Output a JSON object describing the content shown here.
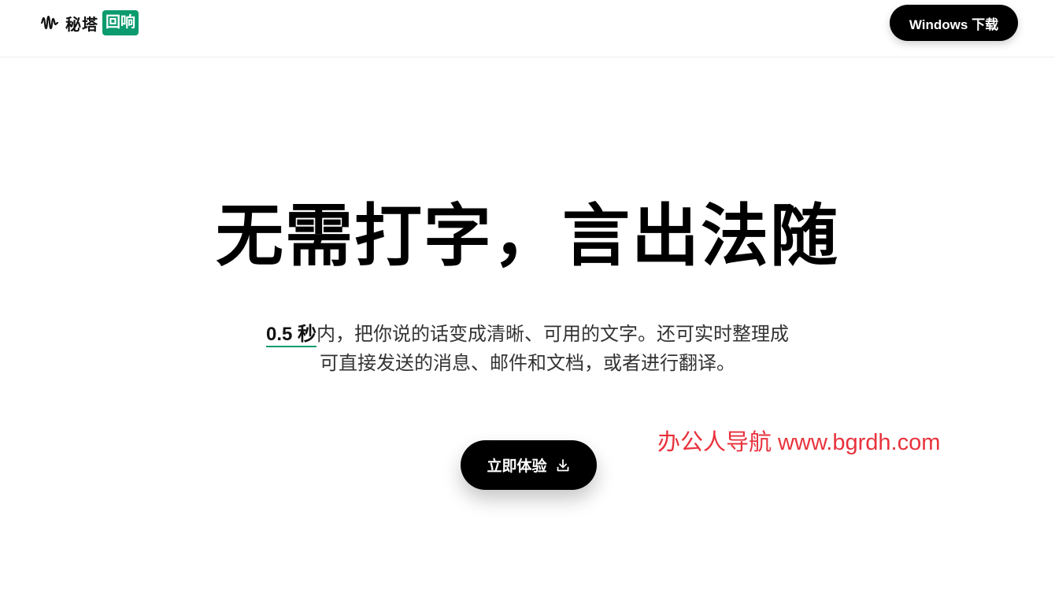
{
  "header": {
    "logo_text": "秘塔",
    "logo_badge": "回响",
    "logo_icon": "waveform-icon",
    "download_label": "Windows 下载"
  },
  "hero": {
    "title": "无需打字，言出法随",
    "desc_highlight": "0.5 秒",
    "desc_line1_rest": "内，把你说的话变成清晰、可用的文字。还可实时整理成",
    "desc_line2": "可直接发送的消息、邮件和文档，或者进行翻译。",
    "cta_label": "立即体验",
    "cta_icon": "download-icon"
  },
  "watermark": "办公人导航 www.bgrdh.com",
  "colors": {
    "accent": "#0b9b6e",
    "button_bg": "#000000",
    "watermark": "#e8323c"
  }
}
